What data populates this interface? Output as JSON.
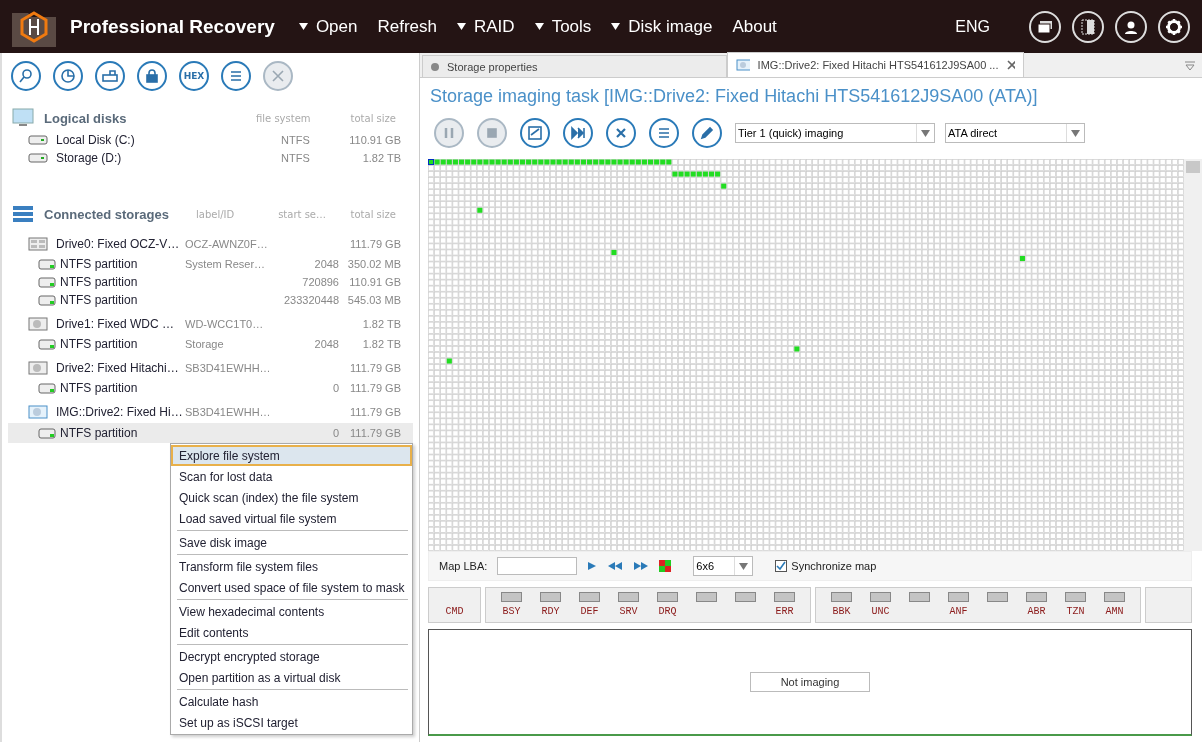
{
  "app": {
    "title": "Professional Recovery"
  },
  "menu": [
    {
      "label": "Open",
      "dropdown": true
    },
    {
      "label": "Refresh",
      "dropdown": false
    },
    {
      "label": "RAID",
      "dropdown": true
    },
    {
      "label": "Tools",
      "dropdown": true
    },
    {
      "label": "Disk image",
      "dropdown": true
    },
    {
      "label": "About",
      "dropdown": false
    }
  ],
  "language": "ENG",
  "left_toolbar": [
    {
      "kind": "search",
      "disabled": false
    },
    {
      "kind": "scan",
      "disabled": false
    },
    {
      "kind": "open",
      "disabled": false
    },
    {
      "kind": "lock",
      "disabled": false
    },
    {
      "kind": "hex",
      "label": "HEX",
      "disabled": false
    },
    {
      "kind": "list",
      "disabled": false
    },
    {
      "kind": "close",
      "disabled": true
    }
  ],
  "logical_disks": {
    "title": "Logical disks",
    "columns": [
      "file system",
      "total size"
    ],
    "items": [
      {
        "name": "Local Disk (C:)",
        "file_system": "NTFS",
        "size": "110.91 GB"
      },
      {
        "name": "Storage (D:)",
        "file_system": "NTFS",
        "size": "1.82 TB"
      }
    ]
  },
  "connected_storages": {
    "title": "Connected storages",
    "columns": [
      "label/ID",
      "start se…",
      "total size"
    ],
    "items": [
      {
        "name": "Drive0: Fixed OCZ-V…",
        "kind": "ssd",
        "label": "OCZ-AWNZ0F…",
        "size": "111.79 GB",
        "children": [
          {
            "name": "NTFS partition",
            "label": "System Reser…",
            "start": "2048",
            "size": "350.02 MB",
            "selected": false
          },
          {
            "name": "NTFS partition",
            "start": "720896",
            "size": "110.91 GB",
            "selected": false
          },
          {
            "name": "NTFS partition",
            "start": "233320448",
            "size": "545.03 MB",
            "selected": false
          }
        ]
      },
      {
        "name": "Drive1: Fixed WDC …",
        "kind": "hdd",
        "label": "WD-WCC1T0…",
        "size": "1.82 TB",
        "children": [
          {
            "name": "NTFS partition",
            "label": "Storage",
            "start": "2048",
            "size": "1.82 TB",
            "selected": false
          }
        ]
      },
      {
        "name": "Drive2: Fixed Hitachi…",
        "kind": "hdd",
        "label": "SB3D41EWHH…",
        "size": "111.79 GB",
        "children": [
          {
            "name": "NTFS partition",
            "start": "0",
            "size": "111.79 GB",
            "selected": false
          }
        ]
      },
      {
        "name": "IMG::Drive2: Fixed Hi…",
        "kind": "image",
        "label": "SB3D41EWHH…",
        "size": "111.79 GB",
        "children": [
          {
            "name": "NTFS partition",
            "start": "0",
            "size": "111.79 GB",
            "selected": true
          }
        ]
      }
    ]
  },
  "context_menu": {
    "groups": [
      [
        {
          "label": "Explore file system",
          "selected": true
        },
        {
          "label": "Scan for lost data",
          "selected": false
        },
        {
          "label": "Quick scan (index) the file system",
          "selected": false
        },
        {
          "label": "Load saved virtual file system",
          "selected": false
        }
      ],
      [
        {
          "label": "Save disk image",
          "selected": false
        }
      ],
      [
        {
          "label": "Transform file system files",
          "selected": false
        },
        {
          "label": "Convert used space of file system to mask",
          "selected": false
        }
      ],
      [
        {
          "label": "View hexadecimal contents",
          "selected": false
        },
        {
          "label": "Edit contents",
          "selected": false
        }
      ],
      [
        {
          "label": "Decrypt encrypted storage",
          "selected": false
        },
        {
          "label": "Open partition as a virtual disk",
          "selected": false
        }
      ],
      [
        {
          "label": "Calculate hash",
          "selected": false
        },
        {
          "label": "Set up as iSCSI target",
          "selected": false
        }
      ]
    ]
  },
  "tabs": [
    {
      "label": "Storage properties",
      "selected": false,
      "closable": false
    },
    {
      "label": "IMG::Drive2: Fixed Hitachi HTS541612J9SA00 ...",
      "selected": true,
      "closable": true
    }
  ],
  "task": {
    "title": "Storage imaging task [IMG::Drive2: Fixed Hitachi HTS541612J9SA00 (ATA)]",
    "toolbar": [
      {
        "kind": "pause",
        "disabled": true
      },
      {
        "kind": "stop",
        "disabled": true
      },
      {
        "kind": "map",
        "disabled": false
      },
      {
        "kind": "skip",
        "disabled": false
      },
      {
        "kind": "cancel",
        "disabled": false
      },
      {
        "kind": "list",
        "disabled": false
      },
      {
        "kind": "edit",
        "disabled": false
      }
    ],
    "mode": "Tier 1 (quick) imaging",
    "access": "ATA direct"
  },
  "map_controls": {
    "label": "Map LBA:",
    "scale": "6x6",
    "sync": {
      "label": "Synchronize map",
      "checked": true
    }
  },
  "registers": [
    {
      "cells": [
        {
          "label": "CMD",
          "lamp": false
        }
      ]
    },
    {
      "cells": [
        {
          "label": "BSY",
          "lamp": true
        },
        {
          "label": "RDY",
          "lamp": true
        },
        {
          "label": "DEF",
          "lamp": true
        },
        {
          "label": "SRV",
          "lamp": true
        },
        {
          "label": "DRQ",
          "lamp": true
        },
        {
          "lamp": true
        },
        {
          "lamp": true
        },
        {
          "label": "ERR",
          "lamp": true
        }
      ]
    },
    {
      "cells": [
        {
          "label": "BBK",
          "lamp": true
        },
        {
          "label": "UNC",
          "lamp": true
        },
        {
          "lamp": true
        },
        {
          "label": "ANF",
          "lamp": true
        },
        {
          "lamp": true
        },
        {
          "label": "ABR",
          "lamp": true
        },
        {
          "label": "TZN",
          "lamp": true
        },
        {
          "label": "AMN",
          "lamp": true
        }
      ]
    },
    {
      "kind": "spacer"
    }
  ],
  "status": "Not imaging"
}
